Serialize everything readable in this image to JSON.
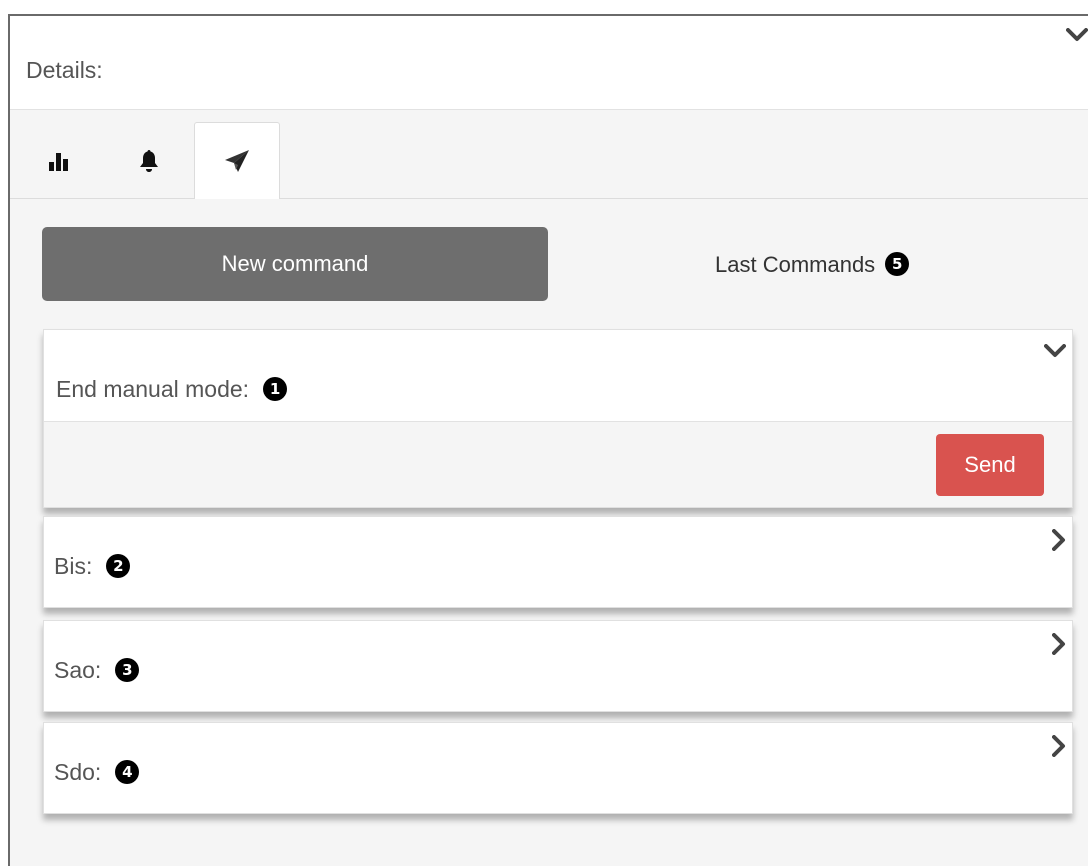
{
  "details": {
    "title": "Details:"
  },
  "tabs": [
    {
      "icon": "bar-chart-icon",
      "active": false
    },
    {
      "icon": "bell-icon",
      "active": false
    },
    {
      "icon": "paper-plane-icon",
      "active": true
    }
  ],
  "commands": {
    "new_command_label": "New command",
    "last_commands_label": "Last Commands",
    "last_commands_badge": "5",
    "button_color": "#6e6e6e"
  },
  "panels": [
    {
      "title": "End manual mode:",
      "badge": "1",
      "expanded": true,
      "send_label": "Send",
      "send_color": "#d9534f"
    },
    {
      "title": "Bis:",
      "badge": "2",
      "expanded": false
    },
    {
      "title": "Sao:",
      "badge": "3",
      "expanded": false
    },
    {
      "title": "Sdo:",
      "badge": "4",
      "expanded": false
    }
  ]
}
